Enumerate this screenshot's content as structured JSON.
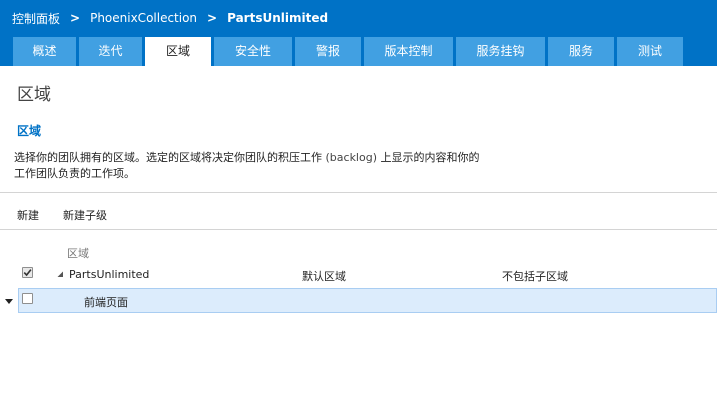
{
  "breadcrumb": {
    "items": [
      "控制面板",
      "PhoenixCollection",
      "PartsUnlimited"
    ],
    "separator": ">"
  },
  "tabs": [
    {
      "label": "概述",
      "active": false
    },
    {
      "label": "迭代",
      "active": false
    },
    {
      "label": "区域",
      "active": true
    },
    {
      "label": "安全性",
      "active": false
    },
    {
      "label": "警报",
      "active": false
    },
    {
      "label": "版本控制",
      "active": false
    },
    {
      "label": "服务挂钩",
      "active": false
    },
    {
      "label": "服务",
      "active": false
    },
    {
      "label": "测试",
      "active": false
    }
  ],
  "page": {
    "title": "区域",
    "section_title": "区域",
    "description": {
      "before": "选择你的团队拥有的区域。选定的区域将决定你团队的积压工作 ",
      "keyword": "(backlog)",
      "after": " 上显示的内容和你的工作团队负责的工作项。"
    }
  },
  "toolbar": {
    "new_label": "新建",
    "new_child_label": "新建子级"
  },
  "grid": {
    "column_header": "区域",
    "rows": [
      {
        "checked": true,
        "name": "PartsUnlimited",
        "default_label": "默认区域",
        "include_label": "不包括子区域"
      },
      {
        "checked": false,
        "name": "前端页面",
        "selected": true
      }
    ]
  },
  "colors": {
    "topbar": "#0072c6",
    "tab": "#41a0e2",
    "accent": "#0072c6",
    "selected_row": "#dcecfc"
  }
}
